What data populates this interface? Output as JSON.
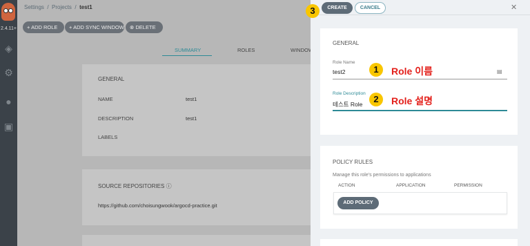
{
  "rail": {
    "version": "2.4.11+"
  },
  "breadcrumb": {
    "settings": "Settings",
    "projects": "Projects",
    "current": "test1"
  },
  "toolbar": {
    "add_role": "ADD ROLE",
    "add_sync_window": "ADD SYNC WINDOW",
    "delete": "DELETE"
  },
  "tabs": [
    "SUMMARY",
    "ROLES",
    "WINDOW"
  ],
  "general": {
    "title": "GENERAL",
    "name_label": "NAME",
    "name_value": "test1",
    "description_label": "DESCRIPTION",
    "description_value": "test1",
    "labels_label": "LABELS"
  },
  "source": {
    "title": "SOURCE REPOSITORIES",
    "repo": "https://github.com/choisungwook/argocd-practice.git"
  },
  "panel": {
    "create": "CREATE",
    "cancel": "CANCEL",
    "general_title": "GENERAL",
    "role_name_label": "Role Name",
    "role_name_value": "test2",
    "role_desc_label": "Role Description",
    "role_desc_value": "테스트 Role",
    "policy_title": "POLICY RULES",
    "policy_hint": "Manage this role's permissions to applications",
    "col_action": "ACTION",
    "col_application": "APPLICATION",
    "col_permission": "PERMISSION",
    "add_policy": "ADD POLICY"
  },
  "annotations": {
    "b1": "1",
    "t1": "Role 이름",
    "b2": "2",
    "t2": "Role 설명",
    "b3": "3"
  }
}
